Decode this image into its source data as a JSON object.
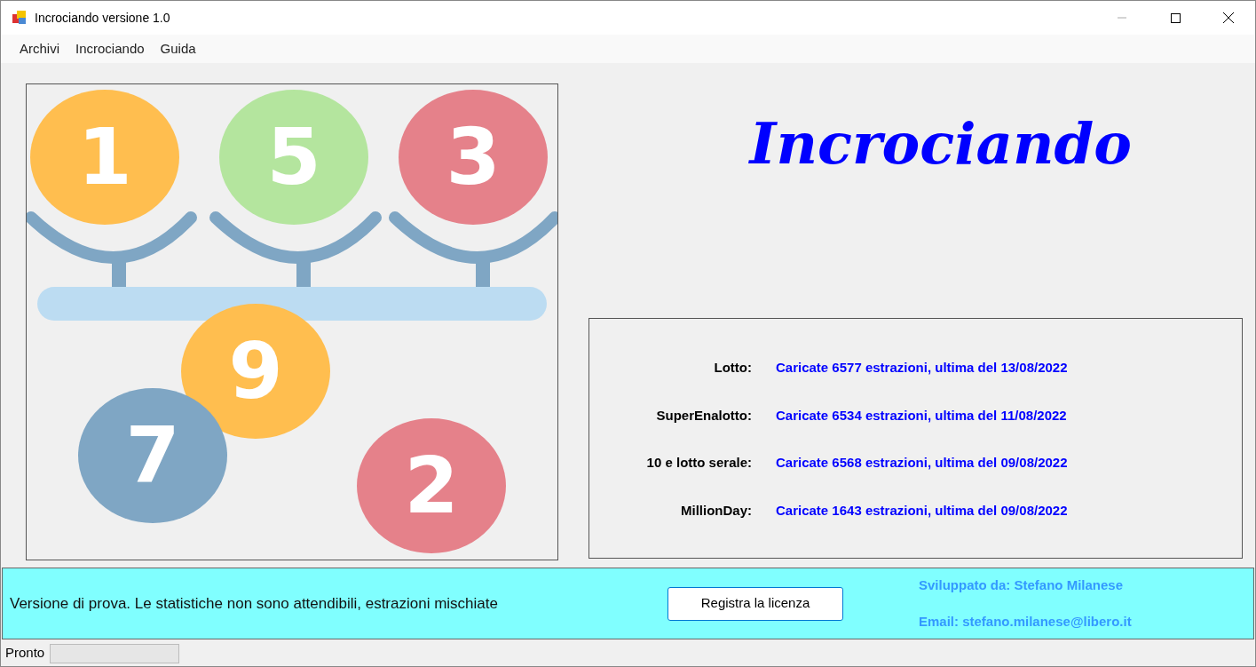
{
  "window": {
    "title": "Incrociando versione 1.0"
  },
  "menu": [
    "Archivi",
    "Incrociando",
    "Guida"
  ],
  "balls": [
    {
      "number": "1",
      "color": "#ffbe4f"
    },
    {
      "number": "5",
      "color": "#b4e59e"
    },
    {
      "number": "3",
      "color": "#e5818a"
    },
    {
      "number": "9",
      "color": "#ffbe4f"
    },
    {
      "number": "7",
      "color": "#7fa6c4"
    },
    {
      "number": "2",
      "color": "#e5818a"
    }
  ],
  "app_title": "Incrociando",
  "archives": [
    {
      "label": "Lotto:",
      "status": "Caricate 6577 estrazioni, ultima del 13/08/2022"
    },
    {
      "label": "SuperEnalotto:",
      "status": "Caricate 6534 estrazioni, ultima del 11/08/2022"
    },
    {
      "label": "10 e lotto serale:",
      "status": "Caricate 6568 estrazioni, ultima del 09/08/2022"
    },
    {
      "label": "MillionDay:",
      "status": "Caricate 1643 estrazioni, ultima del 09/08/2022"
    }
  ],
  "notice": "Versione di prova. Le statistiche non sono attendibili, estrazioni mischiate",
  "register_button": "Registra la licenza",
  "developer": "Sviluppato da: Stefano Milanese",
  "email": "Email: stefano.milanese@libero.it",
  "status_bar": {
    "text": "Pronto",
    "level": 0
  }
}
